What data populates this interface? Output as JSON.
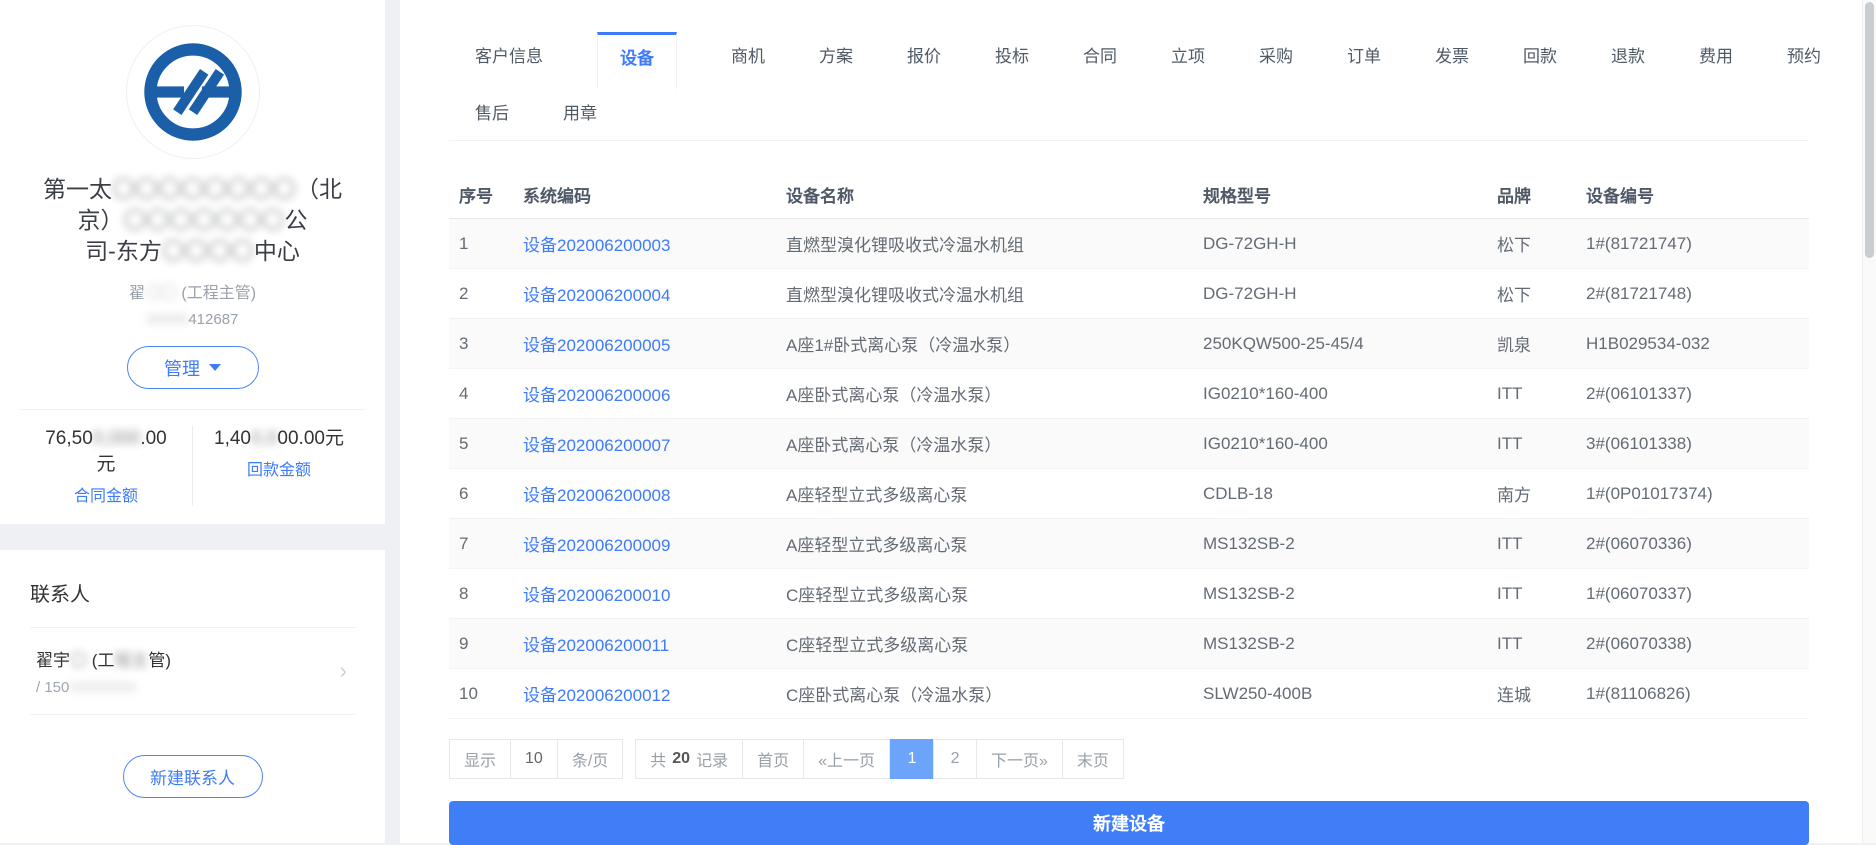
{
  "colors": {
    "primary_blue": "#3e7bfa",
    "button_blue": "#3f7ef7",
    "pagination_active_bg": "#6ba4f8",
    "logo_blue": "#1a5fa8",
    "zebra_row_bg": "#fafafa"
  },
  "sidebar": {
    "company_name_lines": [
      {
        "parts": [
          {
            "t": "第一太"
          },
          {
            "m": "〇〇〇〇〇〇〇〇"
          },
          {
            "t": "（北"
          }
        ]
      },
      {
        "parts": [
          {
            "t": "京）"
          },
          {
            "m": "〇〇〇〇〇〇〇"
          },
          {
            "t": "公"
          }
        ]
      },
      {
        "parts": [
          {
            "t": "司-东方"
          },
          {
            "m": "〇〇〇〇"
          },
          {
            "t": "中心"
          }
        ]
      }
    ],
    "owner": {
      "parts": [
        {
          "t": "翟"
        },
        {
          "m": "〇〇"
        },
        {
          "t": " (工程主管)"
        }
      ]
    },
    "owner_phone": {
      "parts": [
        {
          "m": "00000"
        },
        {
          "t": "412687"
        }
      ]
    },
    "manage_button_label": "管理",
    "metrics": [
      {
        "value_parts": [
          {
            "t": "76,50"
          },
          {
            "m": "0,000"
          },
          {
            "t": ".00"
          }
        ],
        "unit": "元",
        "label": "合同金额"
      },
      {
        "value_parts": [
          {
            "t": "1,40"
          },
          {
            "m": "0,0"
          },
          {
            "t": "00.00元"
          }
        ],
        "unit": "",
        "label": "回款金额"
      }
    ],
    "contacts": {
      "title": "联系人",
      "items": [
        {
          "name_parts": [
            {
              "t": "翟宇"
            },
            {
              "m": "〇"
            },
            {
              "t": " (工"
            },
            {
              "m": "程主"
            },
            {
              "t": "管)"
            }
          ],
          "phone_parts": [
            {
              "t": "/ 150"
            },
            {
              "m": "00000000"
            }
          ]
        }
      ],
      "new_button_label": "新建联系人"
    }
  },
  "tabs": {
    "active": "设备",
    "row1": [
      {
        "key": "customer-info",
        "label": "客户信息"
      },
      {
        "key": "equipment",
        "label": "设备"
      },
      {
        "key": "opportunity",
        "label": "商机"
      },
      {
        "key": "solution",
        "label": "方案"
      },
      {
        "key": "quotation",
        "label": "报价"
      },
      {
        "key": "bidding",
        "label": "投标"
      },
      {
        "key": "contract",
        "label": "合同"
      },
      {
        "key": "project-approval",
        "label": "立项"
      },
      {
        "key": "procurement",
        "label": "采购"
      },
      {
        "key": "order",
        "label": "订单"
      },
      {
        "key": "invoice",
        "label": "发票"
      },
      {
        "key": "payment-collection",
        "label": "回款"
      },
      {
        "key": "refund",
        "label": "退款"
      },
      {
        "key": "expense",
        "label": "费用"
      },
      {
        "key": "appointment",
        "label": "预约"
      }
    ],
    "row2": [
      {
        "key": "after-sales",
        "label": "售后"
      },
      {
        "key": "seal",
        "label": "用章"
      }
    ]
  },
  "table": {
    "header_keys": [
      "seq",
      "code",
      "name",
      "model",
      "brand",
      "number"
    ],
    "headers": [
      "序号",
      "系统编码",
      "设备名称",
      "规格型号",
      "品牌",
      "设备编号"
    ],
    "rows": [
      [
        "1",
        "设备202006200003",
        "直燃型溴化锂吸收式冷温水机组",
        "DG-72GH-H",
        "松下",
        "1#(81721747)"
      ],
      [
        "2",
        "设备202006200004",
        "直燃型溴化锂吸收式冷温水机组",
        "DG-72GH-H",
        "松下",
        "2#(81721748)"
      ],
      [
        "3",
        "设备202006200005",
        "A座1#卧式离心泵（冷温水泵）",
        "250KQW500-25-45/4",
        "凯泉",
        "H1B029534-032"
      ],
      [
        "4",
        "设备202006200006",
        "A座卧式离心泵（冷温水泵）",
        "IG0210*160-400",
        "ITT",
        "2#(06101337)"
      ],
      [
        "5",
        "设备202006200007",
        "A座卧式离心泵（冷温水泵）",
        "IG0210*160-400",
        "ITT",
        "3#(06101338)"
      ],
      [
        "6",
        "设备202006200008",
        "A座轻型立式多级离心泵",
        "CDLB-18",
        "南方",
        "1#(0P01017374)"
      ],
      [
        "7",
        "设备202006200009",
        "A座轻型立式多级离心泵",
        "MS132SB-2",
        "ITT",
        "2#(06070336)"
      ],
      [
        "8",
        "设备202006200010",
        "C座轻型立式多级离心泵",
        "MS132SB-2",
        "ITT",
        "1#(06070337)"
      ],
      [
        "9",
        "设备202006200011",
        "C座轻型立式多级离心泵",
        "MS132SB-2",
        "ITT",
        "2#(06070338)"
      ],
      [
        "10",
        "设备202006200012",
        "C座卧式离心泵（冷温水泵）",
        "SLW250-400B",
        "连城",
        "1#(81106826)"
      ]
    ]
  },
  "pagination": {
    "show_label": "显示",
    "page_size": "10",
    "per_page_label": "条/页",
    "total_prefix": "共",
    "total_count": "20",
    "total_suffix": "记录",
    "first_label": "首页",
    "prev_label": "«上一页",
    "pages": [
      "1",
      "2"
    ],
    "active_page": "1",
    "next_label": "下一页»",
    "last_label": "末页"
  },
  "new_device_button_label": "新建设备"
}
